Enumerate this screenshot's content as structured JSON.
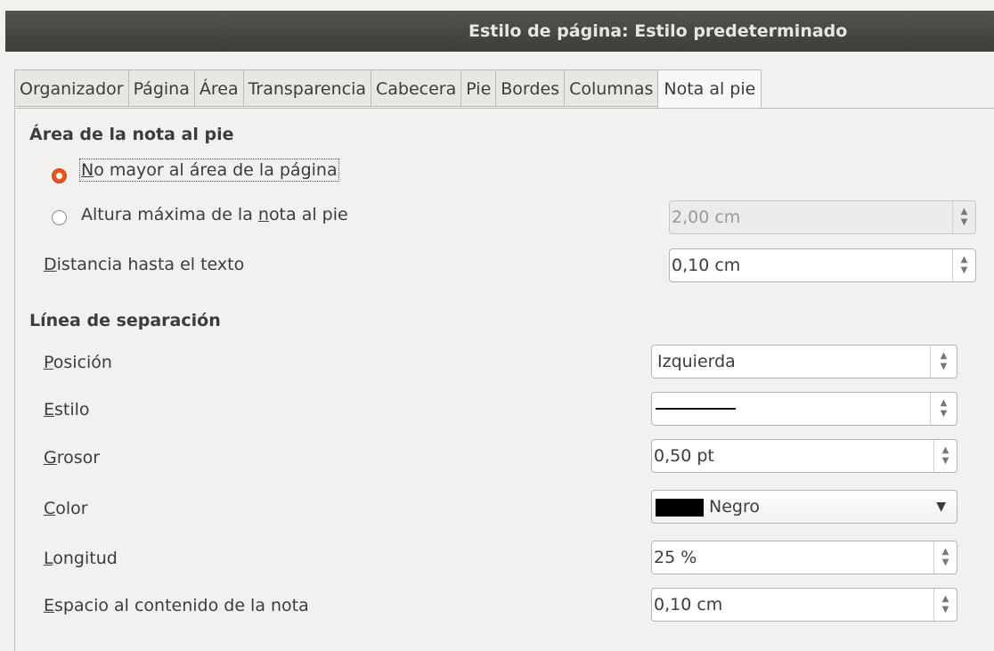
{
  "window": {
    "title": "Estilo de página: Estilo predeterminado"
  },
  "tabs": [
    {
      "label": "Organizador"
    },
    {
      "label": "Página"
    },
    {
      "label": "Área"
    },
    {
      "label": "Transparencia"
    },
    {
      "label": "Cabecera"
    },
    {
      "label": "Pie"
    },
    {
      "label": "Bordes"
    },
    {
      "label": "Columnas"
    },
    {
      "label": "Nota al pie",
      "active": true
    }
  ],
  "footnote_area": {
    "heading": "Área de la nota al pie",
    "option_not_larger": "No mayor al área de la página",
    "option_max_height_pre": "Altura máxima de la ",
    "option_max_height_ul": "n",
    "option_max_height_post": "ota al pie",
    "max_height_value": "2,00 cm",
    "selected_option": "No mayor al área de la página",
    "distance_label_ul": "D",
    "distance_label_rest": "istancia hasta el texto",
    "distance_value": "0,10 cm"
  },
  "separator_line": {
    "heading": "Línea de separación",
    "position_label_ul": "P",
    "position_label_rest": "osición",
    "position_value": "Izquierda",
    "style_label_ul": "E",
    "style_label_rest": "stilo",
    "weight_label_ul": "G",
    "weight_label_rest": "rosor",
    "weight_value": "0,50 pt",
    "color_label_ul": "C",
    "color_label_rest": "olor",
    "color_value": "Negro",
    "color_hex": "#000000",
    "length_label_ul": "L",
    "length_label_rest": "ongitud",
    "length_value": "25 %",
    "spacing_label_ul": "E",
    "spacing_label_rest": "spacio al contenido de la nota",
    "spacing_value": "0,10 cm"
  },
  "icons": {
    "spin_up": "▲",
    "spin_down": "▼",
    "dropdown": "▼"
  }
}
